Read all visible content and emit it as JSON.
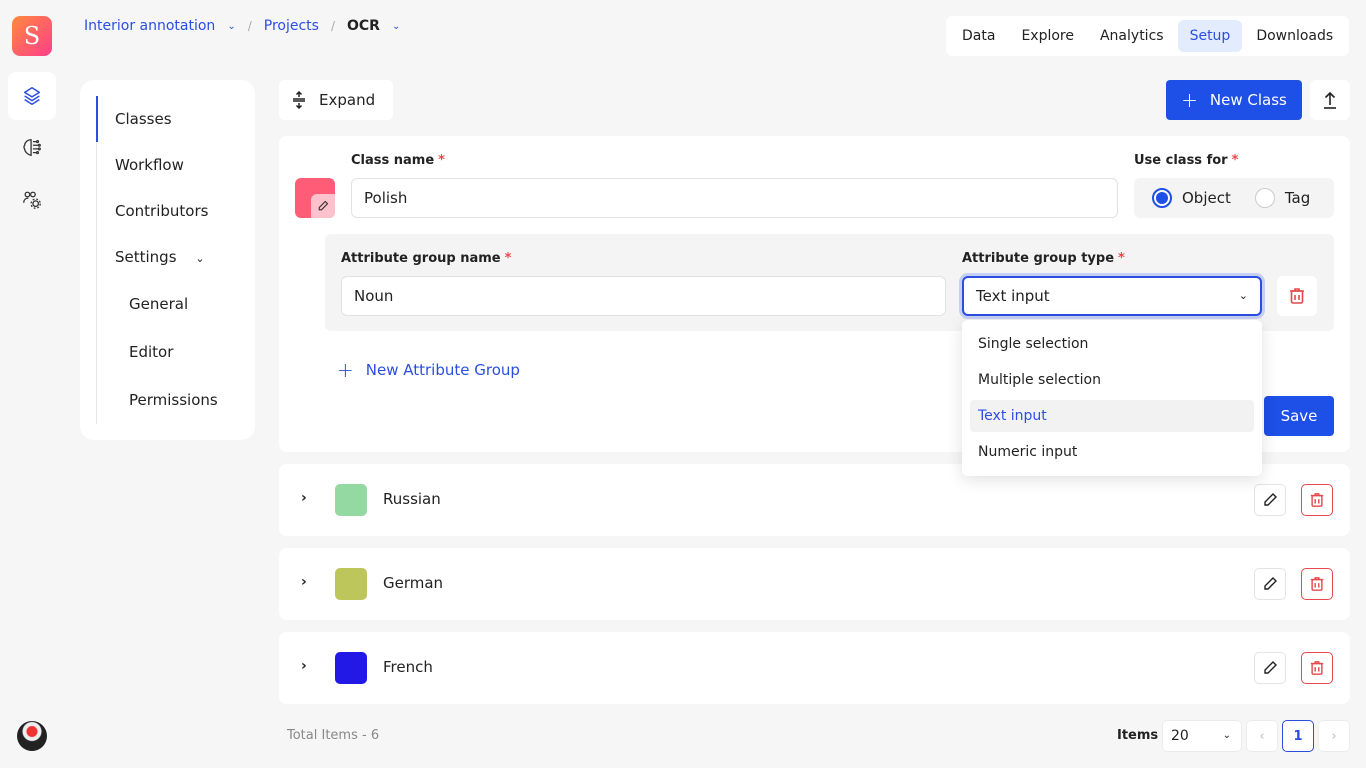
{
  "app": {
    "logo_letter": "S"
  },
  "breadcrumb": {
    "workspace": "Interior annotation",
    "section": "Projects",
    "project": "OCR",
    "separator": "/"
  },
  "topnav": {
    "tabs": [
      {
        "label": "Data",
        "active": false
      },
      {
        "label": "Explore",
        "active": false
      },
      {
        "label": "Analytics",
        "active": false
      },
      {
        "label": "Setup",
        "active": true
      },
      {
        "label": "Downloads",
        "active": false
      }
    ]
  },
  "rail": {
    "icons": [
      "layers-icon",
      "brain-icon",
      "users-gear-icon"
    ]
  },
  "sidenav": {
    "items": [
      {
        "label": "Classes",
        "active": true
      },
      {
        "label": "Workflow"
      },
      {
        "label": "Contributors"
      },
      {
        "label": "Settings",
        "expanded": true
      }
    ],
    "settings_sub": [
      {
        "label": "General"
      },
      {
        "label": "Editor"
      },
      {
        "label": "Permissions"
      }
    ]
  },
  "toolbar": {
    "expand_label": "Expand",
    "new_class_label": "New Class",
    "new_class_icon": "+"
  },
  "edit_form": {
    "class_name_label": "Class name",
    "class_name_value": "Polish",
    "class_color": "#ff5c78",
    "required_mark": "*",
    "use_class_for_label": "Use class for",
    "use_class_options": [
      {
        "label": "Object",
        "selected": true
      },
      {
        "label": "Tag",
        "selected": false
      }
    ],
    "attribute_group_name_label": "Attribute group name",
    "attribute_group_name_value": "Noun",
    "attribute_group_type_label": "Attribute group type",
    "attribute_group_type_value": "Text input",
    "new_attribute_group_label": "New Attribute Group",
    "save_label": "Save"
  },
  "type_dropdown": {
    "options": [
      {
        "label": "Single selection",
        "selected": false
      },
      {
        "label": "Multiple selection",
        "selected": false
      },
      {
        "label": "Text input",
        "selected": true
      },
      {
        "label": "Numeric input",
        "selected": false
      }
    ]
  },
  "classes": [
    {
      "name": "Russian",
      "color": "#95d9a2"
    },
    {
      "name": "German",
      "color": "#bcc65a"
    },
    {
      "name": "French",
      "color": "#2219e6"
    }
  ],
  "footer": {
    "total_items": "Total Items - 6",
    "items_label": "Items",
    "page_size": "20",
    "current_page": "1",
    "prev": "‹",
    "next": "›"
  },
  "colors": {
    "accent": "#1e4fe6",
    "link": "#2b4ee0",
    "danger": "#e5484d"
  }
}
